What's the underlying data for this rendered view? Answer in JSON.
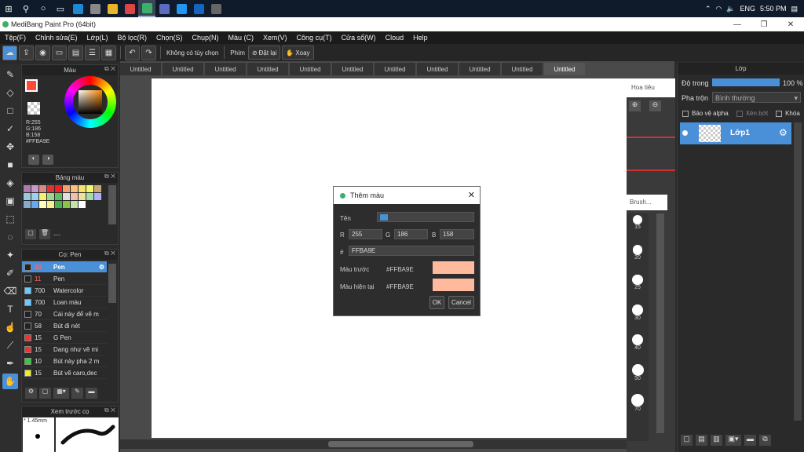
{
  "taskbar": {
    "apps": [
      {
        "name": "edge",
        "color": "#1e88d0"
      },
      {
        "name": "store",
        "color": "#888"
      },
      {
        "name": "folder",
        "color": "#e8b62c"
      },
      {
        "name": "chrome",
        "color": "#d44"
      },
      {
        "name": "medibang",
        "color": "#3cb06a"
      },
      {
        "name": "teams",
        "color": "#5b6bc0"
      },
      {
        "name": "skype",
        "color": "#2196f3"
      },
      {
        "name": "app2",
        "color": "#1565c0"
      },
      {
        "name": "camera",
        "color": "#666"
      }
    ],
    "lang": "ENG",
    "time": "5:50 PM"
  },
  "titlebar": {
    "title": "MediBang Paint Pro (64bit)"
  },
  "menu": [
    "Tệp(F)",
    "Chỉnh sửa(E)",
    "Lớp(L)",
    "Bộ lọc(R)",
    "Chọn(S)",
    "Chụp(N)",
    "Màu (C)",
    "Xem(V)",
    "Công cụ(T)",
    "Cửa sổ(W)",
    "Cloud",
    "Help"
  ],
  "toolbar": {
    "no_options": "Không có tùy chọn",
    "key_label": "Phím",
    "reset_label": "Đặt lại",
    "rotate_label": "Xoay"
  },
  "color_panel": {
    "title": "Màu",
    "r": "R:255",
    "g": "G:186",
    "b": "B:158",
    "hex": "#FFBA9E",
    "fg_color": "#ff4a3a"
  },
  "palette_panel": {
    "title": "Bảng màu",
    "swatches": [
      "#b07ab0",
      "#c59ac5",
      "#d88",
      "#d33",
      "#e22",
      "#f5a070",
      "#f5c080",
      "#f5e070",
      "#f5f570",
      "#c8a878",
      "#98c8e0",
      "#a0d0f0",
      "#f5f070",
      "#9ad890",
      "#60c060",
      "#e0e0e0",
      "#f0c0b0",
      "#f0e0a0",
      "#a0e0a0",
      "#b0b0ff",
      "#8ac",
      "#6ae",
      "#ffb",
      "#f5f090",
      "#4caf50",
      "#8bc34a",
      "#c5e1a5",
      "#fff"
    ],
    "dash": "---"
  },
  "brush_panel": {
    "title": "Cọ: Pen",
    "items": [
      {
        "size": "20",
        "name": "Pen",
        "color": "#222",
        "selected": true
      },
      {
        "size": "11",
        "name": "Pen",
        "color": "#222",
        "selected": false
      },
      {
        "size": "700",
        "name": "Watercolor",
        "color": "#6cf",
        "selected": false
      },
      {
        "size": "700",
        "name": "Loan màu",
        "color": "#6cf",
        "selected": false
      },
      {
        "size": "70",
        "name": "Cái này để vẽ m",
        "color": "#222",
        "selected": false
      },
      {
        "size": "58",
        "name": "Bút đi nét",
        "color": "#222",
        "selected": false
      },
      {
        "size": "15",
        "name": "G Pen",
        "color": "#e33",
        "selected": false
      },
      {
        "size": "15",
        "name": "Dang như vẽ mi",
        "color": "#e33",
        "selected": false
      },
      {
        "size": "10",
        "name": "Bút này pha 2 m",
        "color": "#3c3",
        "selected": false
      },
      {
        "size": "15",
        "name": "Bút vẽ caro,dec",
        "color": "#ee2",
        "selected": false
      }
    ]
  },
  "preview_panel": {
    "title": "Xem trước cọ",
    "size": "* 1.45mm"
  },
  "tabs": [
    "Untitled",
    "Untitled",
    "Untitled",
    "Untitled",
    "Untitled",
    "Untitled",
    "Untitled",
    "Untitled",
    "Untitled",
    "Untitled",
    "Untitled"
  ],
  "nav": {
    "title": "Hoa tiêu",
    "brush_title": "Brush...",
    "sizes": [
      "15",
      "20",
      "25",
      "30",
      "40",
      "50",
      "70"
    ]
  },
  "dialog": {
    "title": "Thêm màu",
    "name_label": "Tên",
    "r_label": "R",
    "r_value": "255",
    "g_label": "G",
    "g_value": "186",
    "b_label": "B",
    "b_value": "158",
    "hash_label": "#",
    "hex_value": "FFBA9E",
    "prev_label": "Màu trước",
    "prev_hex": "#FFBA9E",
    "curr_label": "Màu hiện tại",
    "curr_hex": "#FFBA9E",
    "swatch_color": "#ffba9e",
    "ok": "OK",
    "cancel": "Cancel"
  },
  "layer_panel": {
    "title": "Lớp",
    "opacity_label": "Độ trong",
    "opacity_value": "100 %",
    "blend_label": "Pha trộn",
    "blend_value": "Bình thường",
    "alpha_label": "Bảo vệ alpha",
    "clip_label": "Xén bớt",
    "lock_label": "Khóa",
    "layer_name": "Lớp1"
  }
}
